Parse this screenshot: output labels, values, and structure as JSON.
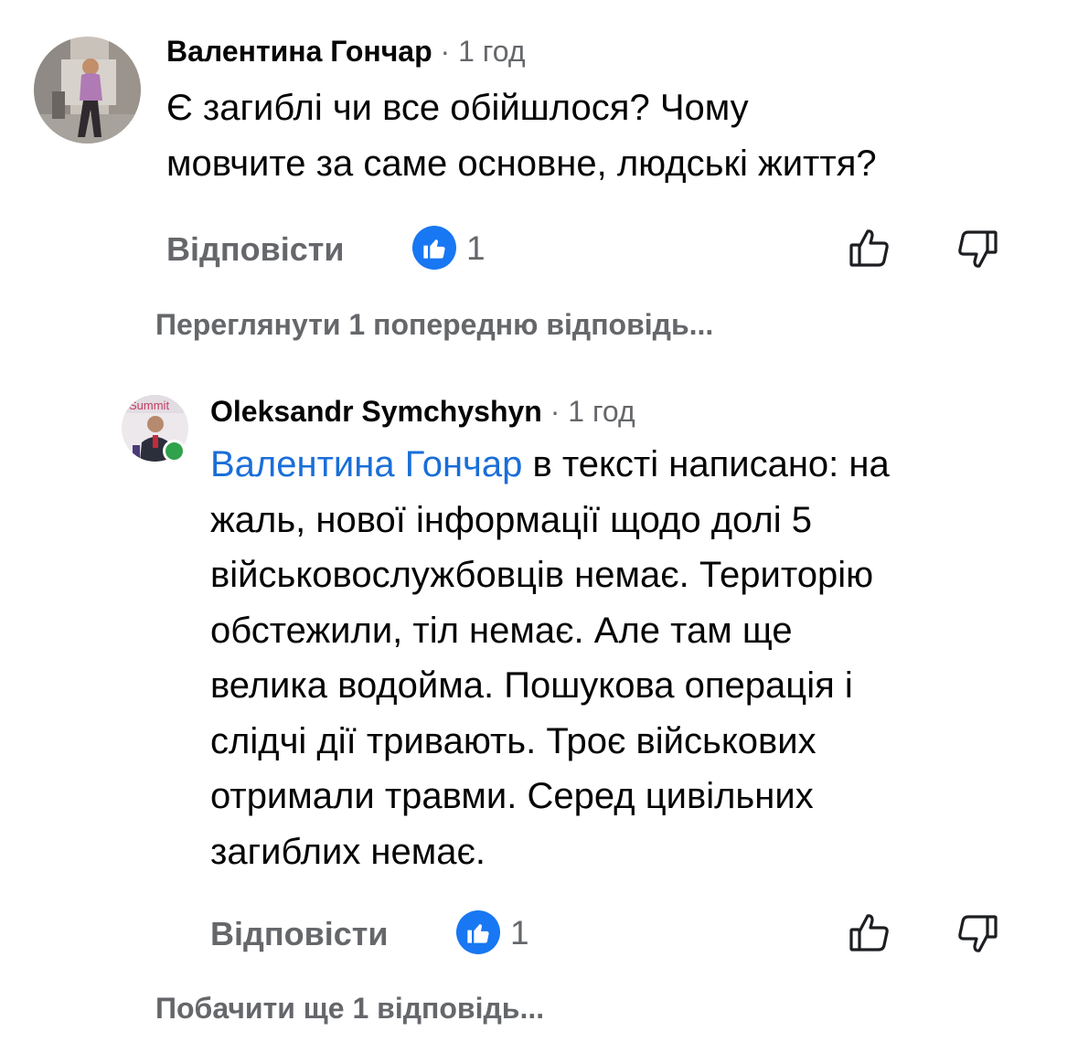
{
  "comment1": {
    "author": "Валентина Гончар",
    "separator": "·",
    "time": "1 год",
    "text_lines": [
      "Є загиблі чи все обійшлося? Чому",
      "мовчите за саме основне, людські життя?"
    ],
    "reply_label": "Відповісти",
    "like_count": "1",
    "reactions": [
      "like-outline-icon",
      "dislike-outline-icon"
    ]
  },
  "view_previous": "Переглянути 1 попередню відповідь...",
  "comment2": {
    "author": "Oleksandr Symchyshyn",
    "separator": "·",
    "time": "1 год",
    "mention": "Валентина Гончар",
    "first_line_rest": " в тексті написано: на",
    "text_lines": [
      "жаль, нової інформації щодо долі 5",
      "військовослужбовців немає. Територію",
      "обстежили, тіл немає. Але там ще",
      "велика водойма. Пошукова операція і",
      "слідчі дії тривають. Троє військових",
      "отримали травми. Серед цивільних",
      "загиблих немає."
    ],
    "reply_label": "Відповісти",
    "like_count": "1",
    "online_status_color": "#31a24c"
  },
  "view_more": "Побачити ще 1 відповідь...",
  "colors": {
    "accent": "#1877f2",
    "mention": "#1a6ed8",
    "secondary_text": "#65676b"
  }
}
